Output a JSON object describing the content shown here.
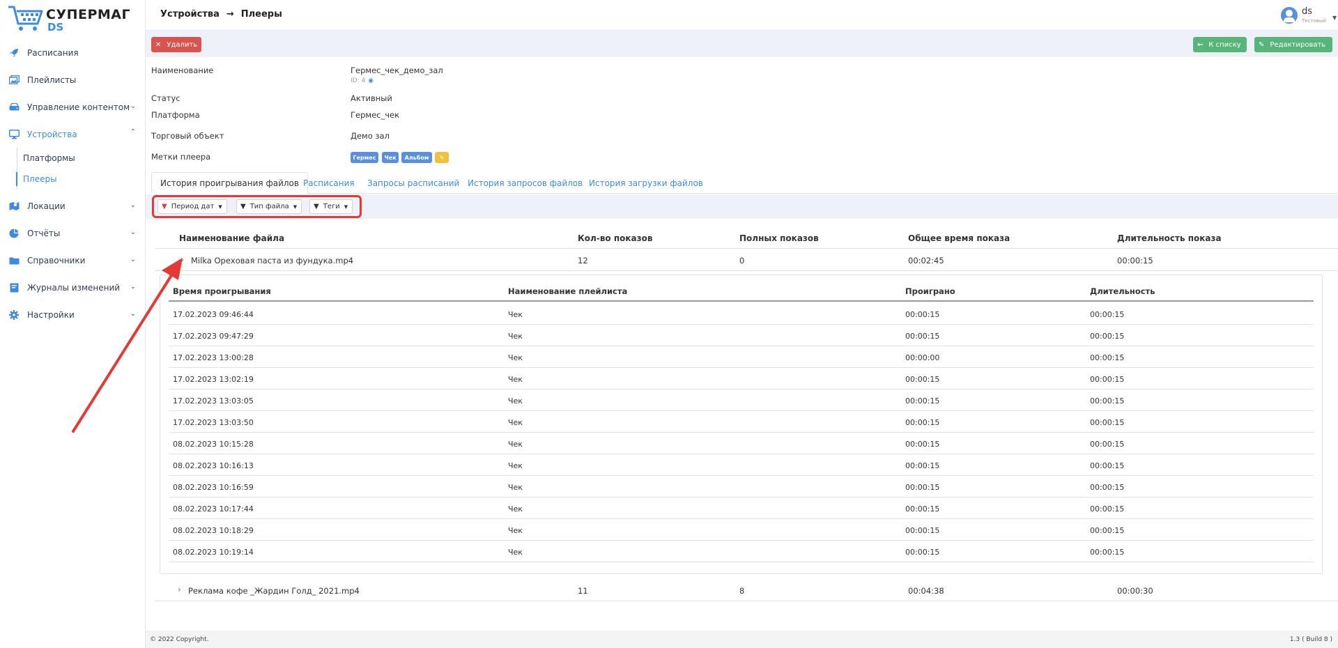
{
  "app": {
    "logo_line1": "СУПЕРМАГ",
    "logo_line2": "DS"
  },
  "sidebar": {
    "items": [
      {
        "label": "Расписания",
        "icon": "rocket-icon"
      },
      {
        "label": "Плейлисты",
        "icon": "images-icon"
      },
      {
        "label": "Управление контентом",
        "icon": "hdd-icon"
      },
      {
        "label": "Устройства",
        "icon": "monitor-icon"
      },
      {
        "label": "Локации",
        "icon": "map-icon"
      },
      {
        "label": "Отчёты",
        "icon": "pie-chart-icon"
      },
      {
        "label": "Справочники",
        "icon": "folder-icon"
      },
      {
        "label": "Журналы изменений",
        "icon": "book-icon"
      },
      {
        "label": "Настройки",
        "icon": "gear-icon"
      }
    ],
    "sub_items": [
      "Платформы",
      "Плееры"
    ]
  },
  "breadcrumb": {
    "parent": "Устройства",
    "current": "Плееры"
  },
  "user": {
    "name": "ds",
    "role": "Тестовый"
  },
  "actions": {
    "delete": "Удалить",
    "to_list": "К списку",
    "edit": "Редактировать"
  },
  "details": {
    "name_label": "Наименование",
    "name_value": "Гермес_чек_демо_зал",
    "id_text": "ID: 4",
    "status_label": "Статус",
    "status_value": "Активный",
    "platform_label": "Платформа",
    "platform_value": "Гермес_чек",
    "store_label": "Торговый объект",
    "store_value": "Демо зал",
    "tags_label": "Метки плеера",
    "tags": [
      "Гермес",
      "Чек",
      "Альбом"
    ]
  },
  "tabs": [
    "История проигрывания файлов",
    "Расписания",
    "Запросы расписаний",
    "История запросов файлов",
    "История загрузки файлов"
  ],
  "filters": [
    "Период дат",
    "Тип файла",
    "Теги"
  ],
  "table": {
    "headers": [
      "Наименование файла",
      "Кол-во показов",
      "Полных показов",
      "Общее время показа",
      "Длительность показа"
    ],
    "rows": [
      {
        "name": "Milka Ореховая паста из фундука.mp4",
        "count": "12",
        "full": "0",
        "total": "00:02:45",
        "duration": "00:00:15"
      },
      {
        "name": "Реклама кофе _Жардин Голд_ 2021.mp4",
        "count": "11",
        "full": "8",
        "total": "00:04:38",
        "duration": "00:00:30"
      }
    ]
  },
  "inner_table": {
    "headers": [
      "Время проигрывания",
      "Наименование плейлиста",
      "Проиграно",
      "Длительность"
    ],
    "rows": [
      [
        "17.02.2023 09:46:44",
        "Чек",
        "00:00:15",
        "00:00:15"
      ],
      [
        "17.02.2023 09:47:29",
        "Чек",
        "00:00:15",
        "00:00:15"
      ],
      [
        "17.02.2023 13:00:28",
        "Чек",
        "00:00:00",
        "00:00:15"
      ],
      [
        "17.02.2023 13:02:19",
        "Чек",
        "00:00:15",
        "00:00:15"
      ],
      [
        "17.02.2023 13:03:05",
        "Чек",
        "00:00:15",
        "00:00:15"
      ],
      [
        "17.02.2023 13:03:50",
        "Чек",
        "00:00:15",
        "00:00:15"
      ],
      [
        "08.02.2023 10:15:28",
        "Чек",
        "00:00:15",
        "00:00:15"
      ],
      [
        "08.02.2023 10:16:13",
        "Чек",
        "00:00:15",
        "00:00:15"
      ],
      [
        "08.02.2023 10:16:59",
        "Чек",
        "00:00:15",
        "00:00:15"
      ],
      [
        "08.02.2023 10:17:44",
        "Чек",
        "00:00:15",
        "00:00:15"
      ],
      [
        "08.02.2023 10:18:29",
        "Чек",
        "00:00:15",
        "00:00:15"
      ],
      [
        "08.02.2023 10:19:14",
        "Чек",
        "00:00:15",
        "00:00:15"
      ]
    ]
  },
  "footer": {
    "copyright": "© 2022 Copyright.",
    "version": "1.3 ( Build 8 )"
  },
  "colors": {
    "accent": "#3d8be0",
    "danger": "#d9534f",
    "success": "#57b57a",
    "highlight": "#e53935"
  }
}
